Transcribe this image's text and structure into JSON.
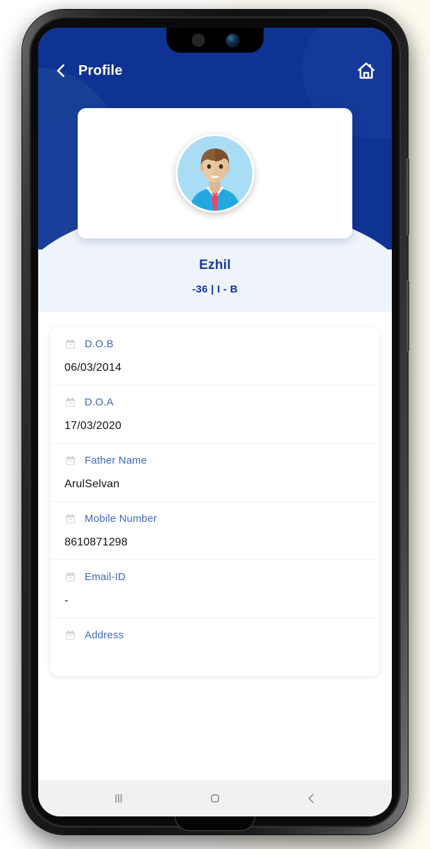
{
  "app": {
    "topbar": {
      "back_icon": "chevron-left-icon",
      "title": "Profile",
      "home_icon": "home-icon"
    },
    "profile": {
      "avatar_icon": "user-avatar-illustration",
      "name": "Ezhil",
      "subtitle": "-36 | I - B"
    },
    "details": {
      "rows": [
        {
          "icon": "calendar-icon",
          "label": "D.O.B",
          "value": "06/03/2014"
        },
        {
          "icon": "calendar-icon",
          "label": "D.O.A",
          "value": "17/03/2020"
        },
        {
          "icon": "calendar-icon",
          "label": "Father Name",
          "value": "ArulSelvan"
        },
        {
          "icon": "calendar-icon",
          "label": "Mobile Number",
          "value": "8610871298"
        },
        {
          "icon": "calendar-icon",
          "label": "Email-ID",
          "value": "-"
        },
        {
          "icon": "calendar-icon",
          "label": "Address",
          "value": ""
        }
      ]
    },
    "navbar": {
      "recents_icon": "recents-icon",
      "home_icon": "home-square-icon",
      "back_icon": "back-chevron-icon"
    },
    "colors": {
      "header_blue": "#0F3393",
      "name_text": "#11399A",
      "label_blue": "#3F68BB",
      "value_black": "#101010",
      "name_band_bg": "#EFF4FC",
      "navbar_bg": "#F1F1F1"
    }
  }
}
